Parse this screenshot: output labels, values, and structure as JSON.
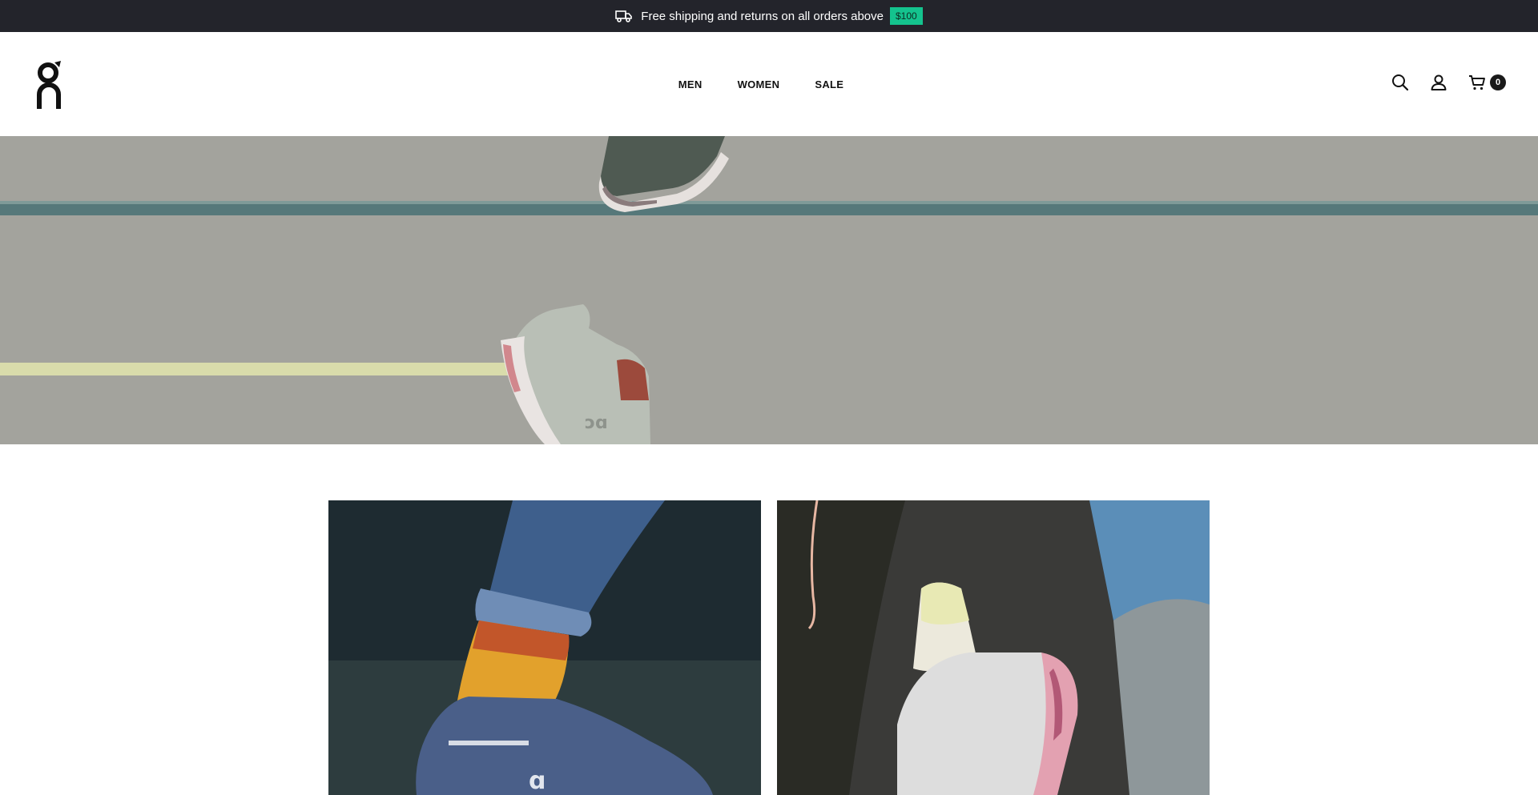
{
  "announcement": {
    "text": "Free shipping and returns on all orders above",
    "threshold": "$100",
    "icon": "delivery-truck-icon"
  },
  "header": {
    "logo_icon": "on-logo-icon",
    "nav": [
      {
        "label": "MEN"
      },
      {
        "label": "WOMEN"
      },
      {
        "label": "SALE"
      }
    ],
    "icons": [
      "search-icon",
      "account-icon",
      "cart-icon"
    ],
    "cart_count": "0"
  },
  "colors": {
    "announcement_bg": "#23242b",
    "threshold_badge": "#14c38e",
    "hero_bg": "#a3a39d"
  },
  "hero": {
    "image": "runners-shoes-hero-image"
  },
  "tiles": [
    {
      "image": "blue-shoe-orange-sock-image"
    },
    {
      "image": "white-pink-shoe-image"
    }
  ]
}
